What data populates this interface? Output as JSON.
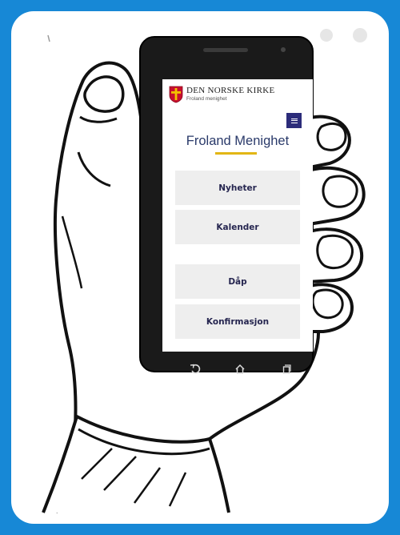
{
  "brand": {
    "name": "DEN NORSKE KIRKE",
    "subtitle": "Froland menighet"
  },
  "page": {
    "title": "Froland Menighet"
  },
  "menu": {
    "icon": "hamburger-menu-icon",
    "color": "#2c2c7a"
  },
  "nav": [
    {
      "label": "Nyheter"
    },
    {
      "label": "Kalender"
    },
    {
      "label": "Dåp"
    },
    {
      "label": "Konfirmasjon"
    }
  ],
  "softkeys": [
    {
      "icon": "back-arrow-icon"
    },
    {
      "icon": "home-icon"
    },
    {
      "icon": "recent-apps-icon"
    }
  ],
  "colors": {
    "background": "#1788d6",
    "accent_rule": "#e2b614",
    "title_text": "#2a3a6a",
    "button_bg": "#eeeeee"
  }
}
